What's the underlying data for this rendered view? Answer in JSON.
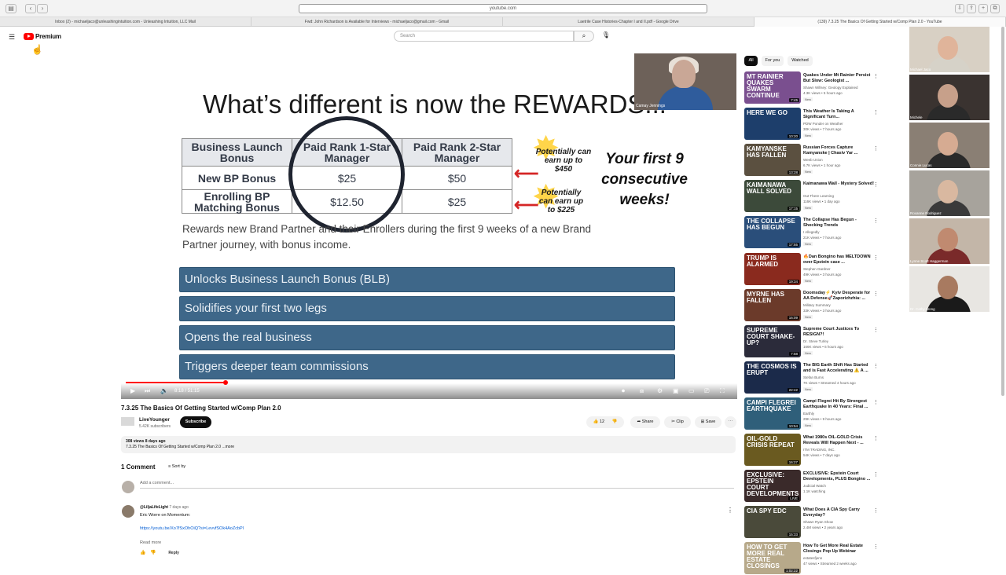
{
  "browser": {
    "url": "youtube.com",
    "tabs": [
      "Inbox (2) - michaeljaco@unleashingintuition.com - Unleashing Intuition, LLC Mail",
      "Fwd: John Richardson is Available for Interviews - michaeljaco@gmail.com - Gmail",
      "Laetrile Case Histories-Chapter I and II.pdf - Google Drive",
      "(139) 7.3.25 The Basics Of Getting Started w/Comp Plan 2.0 - YouTube"
    ]
  },
  "header": {
    "brand": "Premium",
    "search_placeholder": "Search"
  },
  "slide": {
    "title": "What’s different is now the REWARDS...",
    "table_headers": [
      "Business Launch Bonus",
      "Paid Rank 1-Star Manager",
      "Paid Rank 2-Star Manager"
    ],
    "rows": [
      {
        "label": "New BP Bonus",
        "v1": "$25",
        "v2": "$50"
      },
      {
        "label": "Enrolling BP Matching Bonus",
        "v1": "$12.50",
        "v2": "$25"
      }
    ],
    "earn_1": "Potentially can earn up to $450",
    "earn_2": "Potentially can earn up to $225",
    "weeks": "Your first 9 consecutive weeks!",
    "rewards_text": "Rewards new Brand Partner and their Enrollers during the first 9 weeks of a new Brand Partner journey, with bonus income.",
    "bars": [
      "Unlocks Business Launch Bonus (BLB)",
      "Solidifies your first two legs",
      "Opens the real business",
      "Triggers deeper team commissions"
    ]
  },
  "player": {
    "time": "8:18 / 51:15",
    "progress_fraction": 0.165,
    "pip_name": "Camay Jennings"
  },
  "video_info": {
    "title": "7.3.25 The Basics Of Getting Started w/Comp Plan 2.0",
    "channel": "LiveYounger",
    "subscribers": "5.42K subscribers",
    "subscribe": "Subscribe",
    "likes": "12",
    "share": "Share",
    "clip": "Clip",
    "save": "Save",
    "views_line": "308 views  8 days ago",
    "desc_line": "7.3.25 The Basics Of Getting Started w/Comp Plan 2.0 ...more"
  },
  "comments": {
    "count_label": "1 Comment",
    "sort_label": "Sort by",
    "add_placeholder": "Add a comment...",
    "author": "@LiljaLifeLight",
    "time": "7 days ago",
    "text": "Eric Worre on Momentum:",
    "link": "https://youtu.be/Xo7fSxOhOiQ?si=LevvfSOk4AoZcbPl",
    "read_more": "Read more",
    "reply": "Reply"
  },
  "chips": [
    "All",
    "For you",
    "Watched"
  ],
  "recommendations": [
    {
      "thumb_text": "MT RAINIER QUAKES SWARM CONTINUE",
      "thumb_color": "#7a4f8f",
      "duration": "7:45",
      "title": "Quakes Under Mt Rainier Persist But Slow: Geologist ...",
      "channel": "Shawn Willsey: Geology Explained",
      "meta": "4.3K views • 5 hours ago",
      "badge": "New"
    },
    {
      "thumb_text": "HERE WE GO",
      "thumb_color": "#1d3e6b",
      "duration": "10:20",
      "title": "This Weather Is Taking A Significant Turn...",
      "channel": "PDW Ponder on Weather",
      "meta": "30K views • 7 hours ago",
      "badge": "New"
    },
    {
      "thumb_text": "KAMYANSKE HAS FALLEN",
      "thumb_color": "#5b5040",
      "duration": "13:28",
      "title": "Russian Forces Capture Kamyanske | Chasiv Yar ...",
      "channel": "Weeb Union",
      "meta": "6.7K views • 1 hour ago",
      "badge": "New"
    },
    {
      "thumb_text": "KAIMANAWA WALL SOLVED",
      "thumb_color": "#3c4a3a",
      "duration": "17:15",
      "title": "Kaimanawa Wall - Mystery Solved!",
      "channel": "Out There Learning",
      "meta": "116K views • 1 day ago",
      "badge": "New"
    },
    {
      "thumb_text": "THE COLLAPSE HAS BEGUN",
      "thumb_color": "#2a4e7a",
      "duration": "17:55",
      "title": "The Collapse Has Begun - Shocking Trends",
      "channel": "I Allegedly",
      "meta": "21K views • 7 hours ago",
      "badge": "New"
    },
    {
      "thumb_text": "TRUMP IS ALARMED",
      "thumb_color": "#8a2a1e",
      "duration": "19:34",
      "title": "🔥Dan Bongino has MELTDOWN over Epstein case ...",
      "channel": "Stephen Gardner",
      "meta": "49K views • 3 hours ago",
      "badge": "New"
    },
    {
      "thumb_text": "MYRNE HAS FALLEN",
      "thumb_color": "#6b3a2a",
      "duration": "16:09",
      "title": "Doomsday⚡ Kyiv Desperate for AA Defense🚀Zaporizhzhia: ...",
      "channel": "Military Summary",
      "meta": "33K views • 3 hours ago",
      "badge": "New"
    },
    {
      "thumb_text": "SUPREME COURT SHAKE-UP?",
      "thumb_color": "#2b2b3a",
      "duration": "7:58",
      "title": "Supreme Court Justices To RESIGN?!",
      "channel": "Dr. Steve Turley",
      "meta": "166K views • 6 hours ago",
      "badge": "New"
    },
    {
      "thumb_text": "THE COSMOS IS ERUPT",
      "thumb_color": "#1b2a4a",
      "duration": "22:42",
      "title": "The BIG Earth Shift Has Started and is Fast Accelerating ⚠️ A ...",
      "channel": "Stefan Burns",
      "meta": "7K views • Streamed 4 hours ago",
      "badge": "New"
    },
    {
      "thumb_text": "CAMPI FLEGREI EARTHQUAKE",
      "thumb_color": "#2f5f7a",
      "duration": "10:54",
      "title": "Campi Flegrei Hit By Strongest Earthquake In 40 Years: Final ...",
      "channel": "Earthly",
      "meta": "29K views • 9 hours ago",
      "badge": "New"
    },
    {
      "thumb_text": "OIL-GOLD CRISIS REPEAT",
      "thumb_color": "#6a5a20",
      "duration": "16:27",
      "title": "What 1980s OIL-GOLD Crisis Reveals Will Happen Next - ...",
      "channel": "ITM TRADING, INC.",
      "meta": "54K views • 7 days ago",
      "badge": ""
    },
    {
      "thumb_text": "EXCLUSIVE: EPSTEIN COURT DEVELOPMENTS",
      "thumb_color": "#3a2a2a",
      "duration": "LIVE",
      "title": "EXCLUSIVE: Epstein Court Developments, PLUS Bongino ...",
      "channel": "Judicial Watch",
      "meta": "1.1K watching",
      "badge": ""
    },
    {
      "thumb_text": "CIA SPY EDC",
      "thumb_color": "#4a4a3a",
      "duration": "15:33",
      "title": "What Does A CIA Spy Carry Everyday?",
      "channel": "Shawn Ryan Show",
      "meta": "2.4M views • 2 years ago",
      "badge": ""
    },
    {
      "thumb_text": "HOW TO GET MORE REAL ESTATE CLOSINGS",
      "thumb_color": "#b7a98a",
      "duration": "1:02:22",
      "title": "How To Get More Real Estate Closings Pop Up Webinar",
      "channel": "estatesfjenn",
      "meta": "47 views • Streamed 2 weeks ago",
      "badge": ""
    }
  ],
  "participants": [
    {
      "name": "Michael Jaco",
      "bg": "#d8d0c4",
      "skin": "#e0b49a",
      "shirt": "#d6d2c8"
    },
    {
      "name": "Michele",
      "bg": "#3a3330",
      "skin": "#c7a08a",
      "shirt": "#2a2a2a"
    },
    {
      "name": "Connie Lucas",
      "bg": "#8a7f74",
      "skin": "#d6ab92",
      "shirt": "#2a2a2a"
    },
    {
      "name": "Roxanne Rodriguez",
      "bg": "#a7a39c",
      "skin": "#d9b8a0",
      "shirt": "#3a3a3a"
    },
    {
      "name": "Lynne Scott Haggerman",
      "bg": "#c3b6a8",
      "skin": "#c08a70",
      "shirt": "#7a2a2a"
    },
    {
      "name": "Dr. Cathy Wong",
      "bg": "#e8e6e2",
      "skin": "#a87a60",
      "shirt": "#1a1a1a"
    }
  ]
}
